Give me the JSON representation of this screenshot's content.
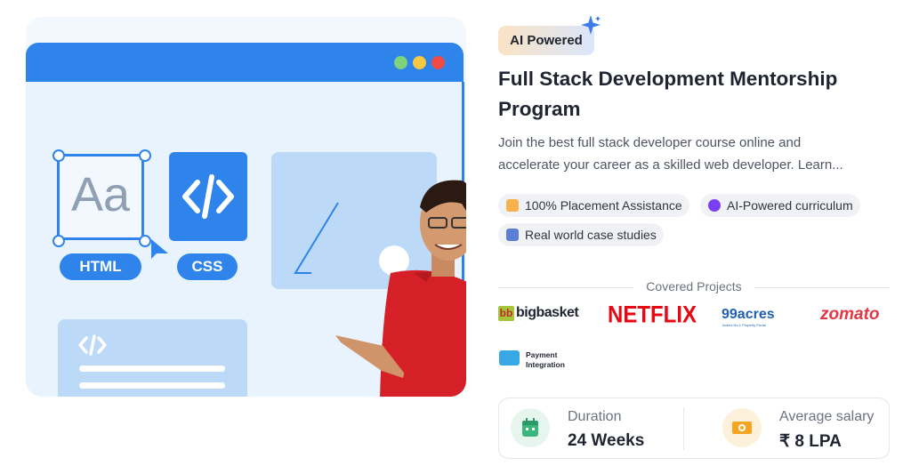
{
  "illustration": {
    "aa_text": "Aa",
    "html_label": "HTML",
    "css_label": "CSS",
    "code_symbol": "</>",
    "window_dots": [
      "#7fd37a",
      "#f7c942",
      "#ef4a43"
    ]
  },
  "badge": {
    "label": "AI Powered"
  },
  "title": "Full Stack Development Mentorship Program",
  "description_line1": "Join the best full stack developer course online and",
  "description_line2": "accelerate your career as a skilled web developer. Learn...",
  "highlights": [
    {
      "label": "100% Placement Assistance",
      "icon": "thumbs-up-icon"
    },
    {
      "label": "AI-Powered curriculum",
      "icon": "ai-sparkle-icon"
    },
    {
      "label": "Real world case studies",
      "icon": "document-icon"
    }
  ],
  "projects": {
    "heading": "Covered Projects",
    "items": [
      {
        "name": "bigbasket",
        "mark": "bb"
      },
      {
        "name": "NETFLIX"
      },
      {
        "name": "99acres",
        "subtext": "India's No.1 Property Portal"
      },
      {
        "name": "zomato"
      },
      {
        "name": "Payment",
        "name_line2": "Integration"
      }
    ]
  },
  "stats": [
    {
      "label": "Duration",
      "value": "24 Weeks",
      "icon": "calendar-icon",
      "color": "#3bb77e"
    },
    {
      "label": "Average salary",
      "value": "₹ 8 LPA",
      "icon": "money-icon",
      "color": "#f5a524"
    }
  ]
}
